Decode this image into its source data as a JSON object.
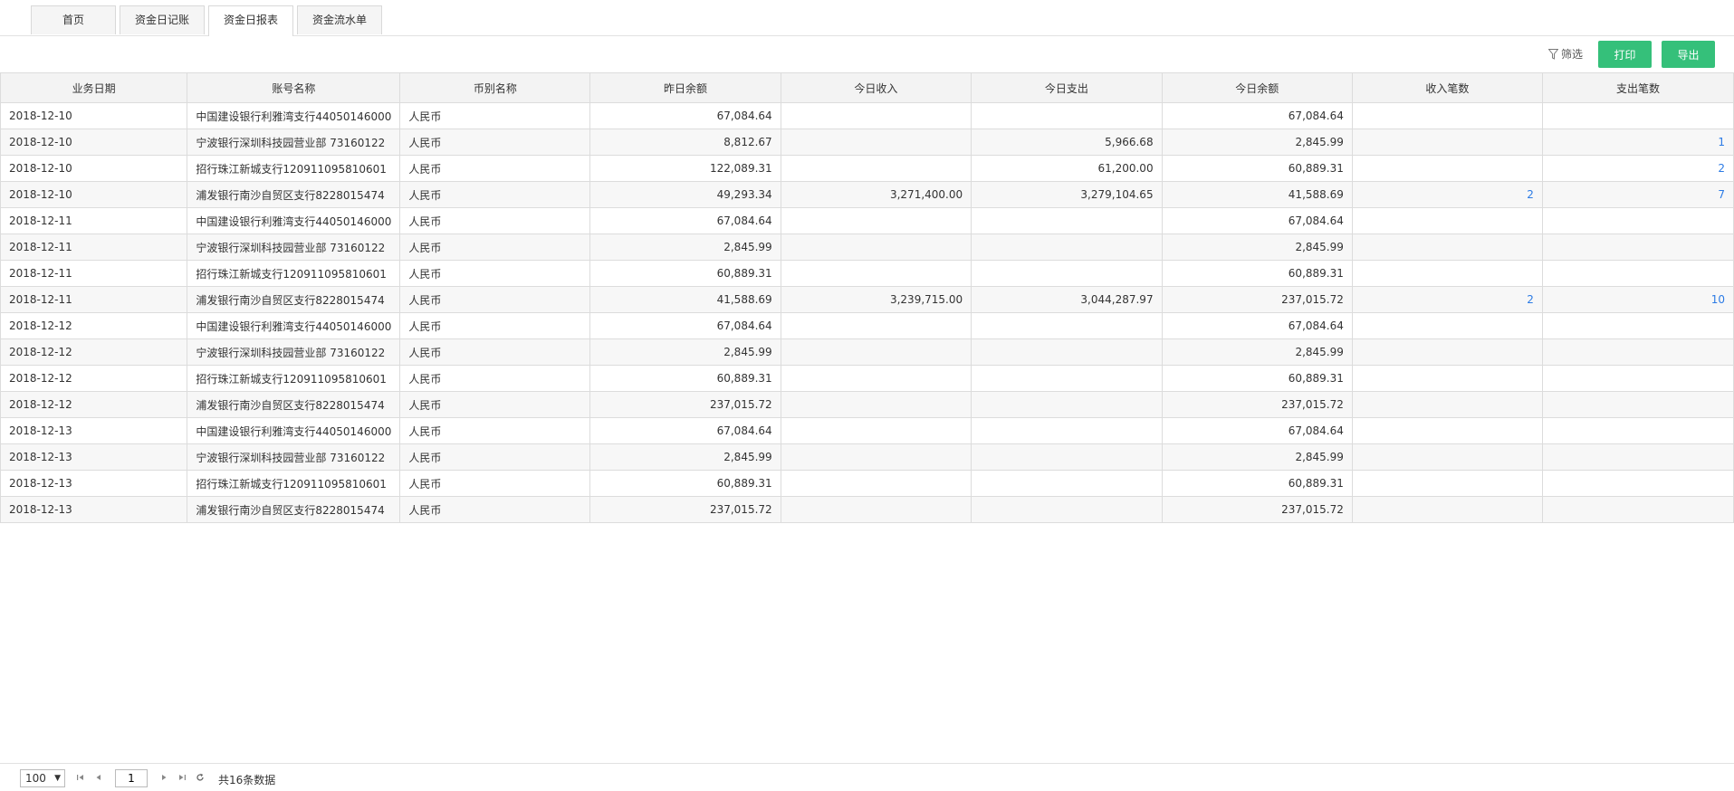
{
  "tabs": [
    {
      "label": "首页"
    },
    {
      "label": "资金日记账"
    },
    {
      "label": "资金日报表"
    },
    {
      "label": "资金流水单"
    }
  ],
  "toolbar": {
    "filter_label": "筛选",
    "print_label": "打印",
    "export_label": "导出",
    "accent_color": "#35c07a"
  },
  "table": {
    "columns": [
      "业务日期",
      "账号名称",
      "币别名称",
      "昨日余额",
      "今日收入",
      "今日支出",
      "今日余额",
      "收入笔数",
      "支出笔数"
    ],
    "rows": [
      [
        "2018-12-10",
        "中国建设银行利雅湾支行44050146000",
        "人民币",
        "67,084.64",
        "",
        "",
        "67,084.64",
        "",
        ""
      ],
      [
        "2018-12-10",
        "宁波银行深圳科技园营业部 73160122",
        "人民币",
        "8,812.67",
        "",
        "5,966.68",
        "2,845.99",
        "",
        "1"
      ],
      [
        "2018-12-10",
        "招行珠江新城支行120911095810601",
        "人民币",
        "122,089.31",
        "",
        "61,200.00",
        "60,889.31",
        "",
        "2"
      ],
      [
        "2018-12-10",
        "浦发银行南沙自贸区支行8228015474",
        "人民币",
        "49,293.34",
        "3,271,400.00",
        "3,279,104.65",
        "41,588.69",
        "2",
        "7"
      ],
      [
        "2018-12-11",
        "中国建设银行利雅湾支行44050146000",
        "人民币",
        "67,084.64",
        "",
        "",
        "67,084.64",
        "",
        ""
      ],
      [
        "2018-12-11",
        "宁波银行深圳科技园营业部 73160122",
        "人民币",
        "2,845.99",
        "",
        "",
        "2,845.99",
        "",
        ""
      ],
      [
        "2018-12-11",
        "招行珠江新城支行120911095810601",
        "人民币",
        "60,889.31",
        "",
        "",
        "60,889.31",
        "",
        ""
      ],
      [
        "2018-12-11",
        "浦发银行南沙自贸区支行8228015474",
        "人民币",
        "41,588.69",
        "3,239,715.00",
        "3,044,287.97",
        "237,015.72",
        "2",
        "10"
      ],
      [
        "2018-12-12",
        "中国建设银行利雅湾支行44050146000",
        "人民币",
        "67,084.64",
        "",
        "",
        "67,084.64",
        "",
        ""
      ],
      [
        "2018-12-12",
        "宁波银行深圳科技园营业部 73160122",
        "人民币",
        "2,845.99",
        "",
        "",
        "2,845.99",
        "",
        ""
      ],
      [
        "2018-12-12",
        "招行珠江新城支行120911095810601",
        "人民币",
        "60,889.31",
        "",
        "",
        "60,889.31",
        "",
        ""
      ],
      [
        "2018-12-12",
        "浦发银行南沙自贸区支行8228015474",
        "人民币",
        "237,015.72",
        "",
        "",
        "237,015.72",
        "",
        ""
      ],
      [
        "2018-12-13",
        "中国建设银行利雅湾支行44050146000",
        "人民币",
        "67,084.64",
        "",
        "",
        "67,084.64",
        "",
        ""
      ],
      [
        "2018-12-13",
        "宁波银行深圳科技园营业部 73160122",
        "人民币",
        "2,845.99",
        "",
        "",
        "2,845.99",
        "",
        ""
      ],
      [
        "2018-12-13",
        "招行珠江新城支行120911095810601",
        "人民币",
        "60,889.31",
        "",
        "",
        "60,889.31",
        "",
        ""
      ],
      [
        "2018-12-13",
        "浦发银行南沙自贸区支行8228015474",
        "人民币",
        "237,015.72",
        "",
        "",
        "237,015.72",
        "",
        ""
      ]
    ]
  },
  "pager": {
    "page_size": "100",
    "current_page": "1",
    "total_label": "共16条数据"
  }
}
